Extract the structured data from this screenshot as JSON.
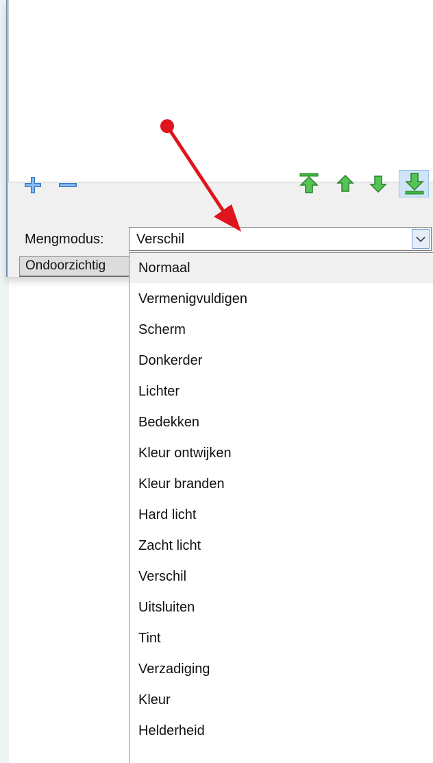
{
  "layer_controls": {
    "add_icon": "plus-icon",
    "remove_icon": "minus-icon",
    "top_icon": "move-to-top-icon",
    "up_icon": "move-up-icon",
    "down_icon": "move-down-icon",
    "bottom_icon": "move-to-bottom-icon"
  },
  "blend": {
    "label": "Mengmodus:",
    "value": "Verschil",
    "dropdown_icon": "chevron-down-icon"
  },
  "opacity_button": "Ondoorzichtig",
  "options": [
    "Normaal",
    "Vermenigvuldigen",
    "Scherm",
    "Donkerder",
    "Lichter",
    "Bedekken",
    "Kleur ontwijken",
    "Kleur branden",
    "Hard licht",
    "Zacht licht",
    "Verschil",
    "Uitsluiten",
    "Tint",
    "Verzadiging",
    "Kleur",
    "Helderheid"
  ],
  "colors": {
    "accent_blue": "#3a78c8",
    "arrow_green": "#3fb83f",
    "annotation_red": "#e0141c"
  }
}
